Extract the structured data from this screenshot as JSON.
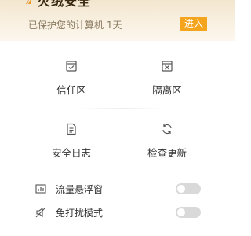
{
  "header": {
    "title": "火绒安全",
    "status_text": "已保护您的计算机 1天",
    "enter_button": "进入"
  },
  "grid": [
    {
      "label": "信任区",
      "icon": "trust-zone-icon"
    },
    {
      "label": "隔离区",
      "icon": "quarantine-icon"
    },
    {
      "label": "安全日志",
      "icon": "log-document-icon"
    },
    {
      "label": "检查更新",
      "icon": "refresh-icon"
    }
  ],
  "settings": [
    {
      "label": "流量悬浮窗",
      "icon": "traffic-chart-icon",
      "enabled": false
    },
    {
      "label": "免打扰模式",
      "icon": "mute-icon",
      "enabled": false
    }
  ],
  "colors": {
    "accent": "#f5a41d",
    "header_bg": "#f6ead6",
    "toggle_off": "#d9d9d9"
  }
}
